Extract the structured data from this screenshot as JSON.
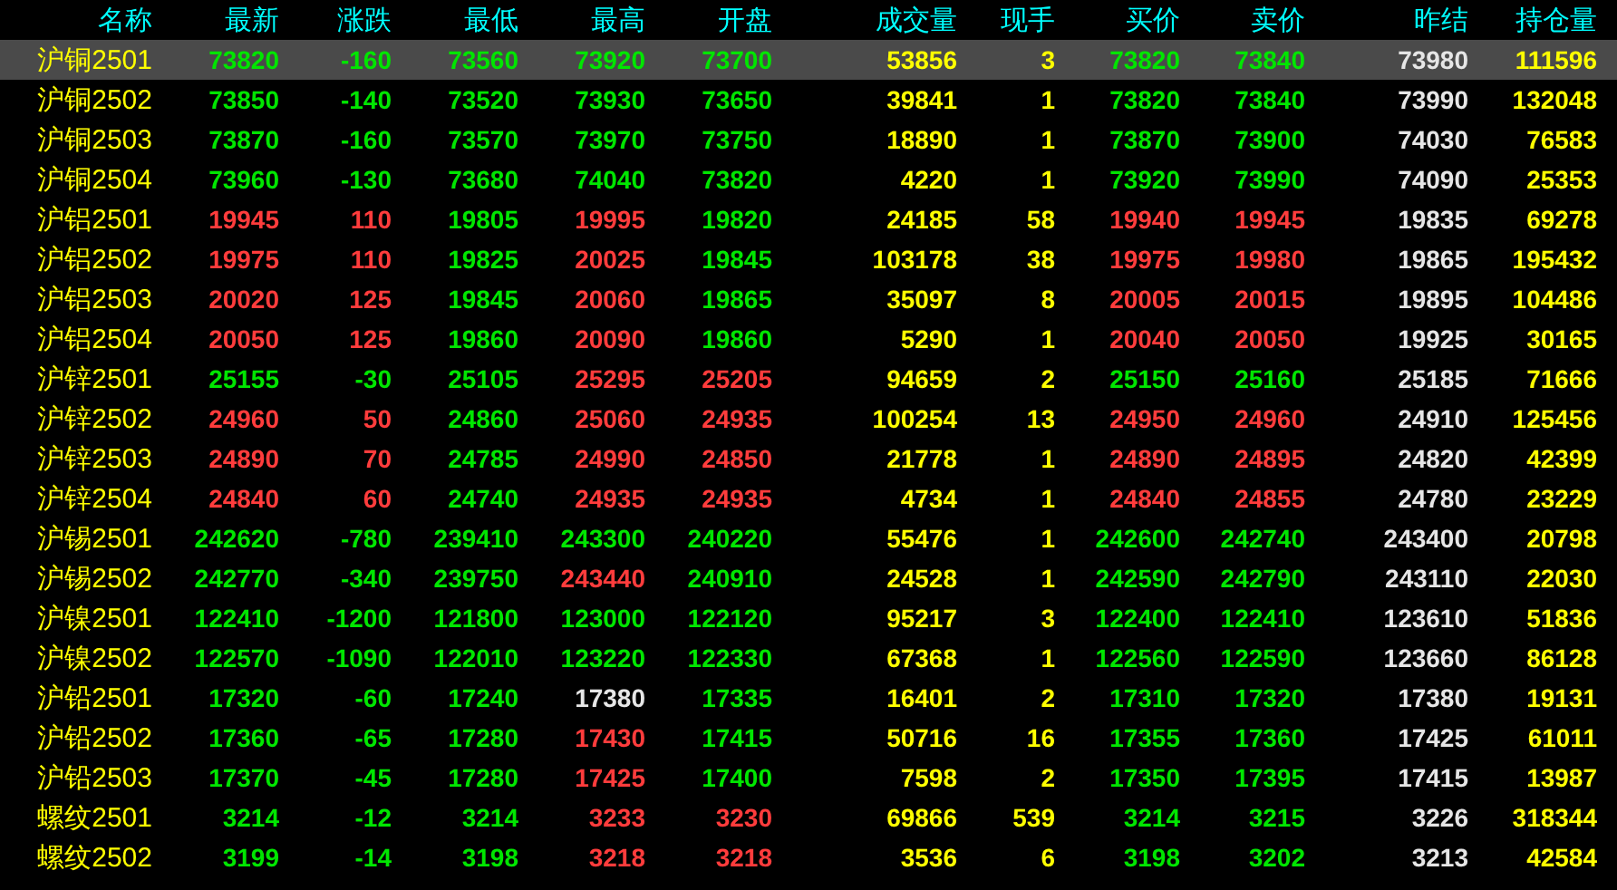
{
  "table": {
    "columns": [
      "名称",
      "最新",
      "涨跌",
      "最低",
      "最高",
      "开盘",
      "成交量",
      "现手",
      "买价",
      "卖价",
      "昨结",
      "持仓量"
    ],
    "rows": [
      {
        "selected": true,
        "cells": [
          {
            "text": "沪铜2501",
            "color": "#ffff00"
          },
          {
            "text": "73820",
            "color": "#00e600"
          },
          {
            "text": "-160",
            "color": "#00e600"
          },
          {
            "text": "73560",
            "color": "#00e600"
          },
          {
            "text": "73920",
            "color": "#00e600"
          },
          {
            "text": "73700",
            "color": "#00e600"
          },
          {
            "text": "53856",
            "color": "#ffff00"
          },
          {
            "text": "3",
            "color": "#ffff00"
          },
          {
            "text": "73820",
            "color": "#00e600"
          },
          {
            "text": "73840",
            "color": "#00e600"
          },
          {
            "text": "73980",
            "color": "#e6e6e6"
          },
          {
            "text": "111596",
            "color": "#ffff00"
          }
        ]
      },
      {
        "selected": false,
        "cells": [
          {
            "text": "沪铜2502",
            "color": "#ffff00"
          },
          {
            "text": "73850",
            "color": "#00e600"
          },
          {
            "text": "-140",
            "color": "#00e600"
          },
          {
            "text": "73520",
            "color": "#00e600"
          },
          {
            "text": "73930",
            "color": "#00e600"
          },
          {
            "text": "73650",
            "color": "#00e600"
          },
          {
            "text": "39841",
            "color": "#ffff00"
          },
          {
            "text": "1",
            "color": "#ffff00"
          },
          {
            "text": "73820",
            "color": "#00e600"
          },
          {
            "text": "73840",
            "color": "#00e600"
          },
          {
            "text": "73990",
            "color": "#e6e6e6"
          },
          {
            "text": "132048",
            "color": "#ffff00"
          }
        ]
      },
      {
        "selected": false,
        "cells": [
          {
            "text": "沪铜2503",
            "color": "#ffff00"
          },
          {
            "text": "73870",
            "color": "#00e600"
          },
          {
            "text": "-160",
            "color": "#00e600"
          },
          {
            "text": "73570",
            "color": "#00e600"
          },
          {
            "text": "73970",
            "color": "#00e600"
          },
          {
            "text": "73750",
            "color": "#00e600"
          },
          {
            "text": "18890",
            "color": "#ffff00"
          },
          {
            "text": "1",
            "color": "#ffff00"
          },
          {
            "text": "73870",
            "color": "#00e600"
          },
          {
            "text": "73900",
            "color": "#00e600"
          },
          {
            "text": "74030",
            "color": "#e6e6e6"
          },
          {
            "text": "76583",
            "color": "#ffff00"
          }
        ]
      },
      {
        "selected": false,
        "cells": [
          {
            "text": "沪铜2504",
            "color": "#ffff00"
          },
          {
            "text": "73960",
            "color": "#00e600"
          },
          {
            "text": "-130",
            "color": "#00e600"
          },
          {
            "text": "73680",
            "color": "#00e600"
          },
          {
            "text": "74040",
            "color": "#00e600"
          },
          {
            "text": "73820",
            "color": "#00e600"
          },
          {
            "text": "4220",
            "color": "#ffff00"
          },
          {
            "text": "1",
            "color": "#ffff00"
          },
          {
            "text": "73920",
            "color": "#00e600"
          },
          {
            "text": "73990",
            "color": "#00e600"
          },
          {
            "text": "74090",
            "color": "#e6e6e6"
          },
          {
            "text": "25353",
            "color": "#ffff00"
          }
        ]
      },
      {
        "selected": false,
        "cells": [
          {
            "text": "沪铝2501",
            "color": "#ffff00"
          },
          {
            "text": "19945",
            "color": "#ff3c3c"
          },
          {
            "text": "110",
            "color": "#ff3c3c"
          },
          {
            "text": "19805",
            "color": "#00e600"
          },
          {
            "text": "19995",
            "color": "#ff3c3c"
          },
          {
            "text": "19820",
            "color": "#00e600"
          },
          {
            "text": "24185",
            "color": "#ffff00"
          },
          {
            "text": "58",
            "color": "#ffff00"
          },
          {
            "text": "19940",
            "color": "#ff3c3c"
          },
          {
            "text": "19945",
            "color": "#ff3c3c"
          },
          {
            "text": "19835",
            "color": "#e6e6e6"
          },
          {
            "text": "69278",
            "color": "#ffff00"
          }
        ]
      },
      {
        "selected": false,
        "cells": [
          {
            "text": "沪铝2502",
            "color": "#ffff00"
          },
          {
            "text": "19975",
            "color": "#ff3c3c"
          },
          {
            "text": "110",
            "color": "#ff3c3c"
          },
          {
            "text": "19825",
            "color": "#00e600"
          },
          {
            "text": "20025",
            "color": "#ff3c3c"
          },
          {
            "text": "19845",
            "color": "#00e600"
          },
          {
            "text": "103178",
            "color": "#ffff00"
          },
          {
            "text": "38",
            "color": "#ffff00"
          },
          {
            "text": "19975",
            "color": "#ff3c3c"
          },
          {
            "text": "19980",
            "color": "#ff3c3c"
          },
          {
            "text": "19865",
            "color": "#e6e6e6"
          },
          {
            "text": "195432",
            "color": "#ffff00"
          }
        ]
      },
      {
        "selected": false,
        "cells": [
          {
            "text": "沪铝2503",
            "color": "#ffff00"
          },
          {
            "text": "20020",
            "color": "#ff3c3c"
          },
          {
            "text": "125",
            "color": "#ff3c3c"
          },
          {
            "text": "19845",
            "color": "#00e600"
          },
          {
            "text": "20060",
            "color": "#ff3c3c"
          },
          {
            "text": "19865",
            "color": "#00e600"
          },
          {
            "text": "35097",
            "color": "#ffff00"
          },
          {
            "text": "8",
            "color": "#ffff00"
          },
          {
            "text": "20005",
            "color": "#ff3c3c"
          },
          {
            "text": "20015",
            "color": "#ff3c3c"
          },
          {
            "text": "19895",
            "color": "#e6e6e6"
          },
          {
            "text": "104486",
            "color": "#ffff00"
          }
        ]
      },
      {
        "selected": false,
        "cells": [
          {
            "text": "沪铝2504",
            "color": "#ffff00"
          },
          {
            "text": "20050",
            "color": "#ff3c3c"
          },
          {
            "text": "125",
            "color": "#ff3c3c"
          },
          {
            "text": "19860",
            "color": "#00e600"
          },
          {
            "text": "20090",
            "color": "#ff3c3c"
          },
          {
            "text": "19860",
            "color": "#00e600"
          },
          {
            "text": "5290",
            "color": "#ffff00"
          },
          {
            "text": "1",
            "color": "#ffff00"
          },
          {
            "text": "20040",
            "color": "#ff3c3c"
          },
          {
            "text": "20050",
            "color": "#ff3c3c"
          },
          {
            "text": "19925",
            "color": "#e6e6e6"
          },
          {
            "text": "30165",
            "color": "#ffff00"
          }
        ]
      },
      {
        "selected": false,
        "cells": [
          {
            "text": "沪锌2501",
            "color": "#ffff00"
          },
          {
            "text": "25155",
            "color": "#00e600"
          },
          {
            "text": "-30",
            "color": "#00e600"
          },
          {
            "text": "25105",
            "color": "#00e600"
          },
          {
            "text": "25295",
            "color": "#ff3c3c"
          },
          {
            "text": "25205",
            "color": "#ff3c3c"
          },
          {
            "text": "94659",
            "color": "#ffff00"
          },
          {
            "text": "2",
            "color": "#ffff00"
          },
          {
            "text": "25150",
            "color": "#00e600"
          },
          {
            "text": "25160",
            "color": "#00e600"
          },
          {
            "text": "25185",
            "color": "#e6e6e6"
          },
          {
            "text": "71666",
            "color": "#ffff00"
          }
        ]
      },
      {
        "selected": false,
        "cells": [
          {
            "text": "沪锌2502",
            "color": "#ffff00"
          },
          {
            "text": "24960",
            "color": "#ff3c3c"
          },
          {
            "text": "50",
            "color": "#ff3c3c"
          },
          {
            "text": "24860",
            "color": "#00e600"
          },
          {
            "text": "25060",
            "color": "#ff3c3c"
          },
          {
            "text": "24935",
            "color": "#ff3c3c"
          },
          {
            "text": "100254",
            "color": "#ffff00"
          },
          {
            "text": "13",
            "color": "#ffff00"
          },
          {
            "text": "24950",
            "color": "#ff3c3c"
          },
          {
            "text": "24960",
            "color": "#ff3c3c"
          },
          {
            "text": "24910",
            "color": "#e6e6e6"
          },
          {
            "text": "125456",
            "color": "#ffff00"
          }
        ]
      },
      {
        "selected": false,
        "cells": [
          {
            "text": "沪锌2503",
            "color": "#ffff00"
          },
          {
            "text": "24890",
            "color": "#ff3c3c"
          },
          {
            "text": "70",
            "color": "#ff3c3c"
          },
          {
            "text": "24785",
            "color": "#00e600"
          },
          {
            "text": "24990",
            "color": "#ff3c3c"
          },
          {
            "text": "24850",
            "color": "#ff3c3c"
          },
          {
            "text": "21778",
            "color": "#ffff00"
          },
          {
            "text": "1",
            "color": "#ffff00"
          },
          {
            "text": "24890",
            "color": "#ff3c3c"
          },
          {
            "text": "24895",
            "color": "#ff3c3c"
          },
          {
            "text": "24820",
            "color": "#e6e6e6"
          },
          {
            "text": "42399",
            "color": "#ffff00"
          }
        ]
      },
      {
        "selected": false,
        "cells": [
          {
            "text": "沪锌2504",
            "color": "#ffff00"
          },
          {
            "text": "24840",
            "color": "#ff3c3c"
          },
          {
            "text": "60",
            "color": "#ff3c3c"
          },
          {
            "text": "24740",
            "color": "#00e600"
          },
          {
            "text": "24935",
            "color": "#ff3c3c"
          },
          {
            "text": "24935",
            "color": "#ff3c3c"
          },
          {
            "text": "4734",
            "color": "#ffff00"
          },
          {
            "text": "1",
            "color": "#ffff00"
          },
          {
            "text": "24840",
            "color": "#ff3c3c"
          },
          {
            "text": "24855",
            "color": "#ff3c3c"
          },
          {
            "text": "24780",
            "color": "#e6e6e6"
          },
          {
            "text": "23229",
            "color": "#ffff00"
          }
        ]
      },
      {
        "selected": false,
        "cells": [
          {
            "text": "沪锡2501",
            "color": "#ffff00"
          },
          {
            "text": "242620",
            "color": "#00e600"
          },
          {
            "text": "-780",
            "color": "#00e600"
          },
          {
            "text": "239410",
            "color": "#00e600"
          },
          {
            "text": "243300",
            "color": "#00e600"
          },
          {
            "text": "240220",
            "color": "#00e600"
          },
          {
            "text": "55476",
            "color": "#ffff00"
          },
          {
            "text": "1",
            "color": "#ffff00"
          },
          {
            "text": "242600",
            "color": "#00e600"
          },
          {
            "text": "242740",
            "color": "#00e600"
          },
          {
            "text": "243400",
            "color": "#e6e6e6"
          },
          {
            "text": "20798",
            "color": "#ffff00"
          }
        ]
      },
      {
        "selected": false,
        "cells": [
          {
            "text": "沪锡2502",
            "color": "#ffff00"
          },
          {
            "text": "242770",
            "color": "#00e600"
          },
          {
            "text": "-340",
            "color": "#00e600"
          },
          {
            "text": "239750",
            "color": "#00e600"
          },
          {
            "text": "243440",
            "color": "#ff3c3c"
          },
          {
            "text": "240910",
            "color": "#00e600"
          },
          {
            "text": "24528",
            "color": "#ffff00"
          },
          {
            "text": "1",
            "color": "#ffff00"
          },
          {
            "text": "242590",
            "color": "#00e600"
          },
          {
            "text": "242790",
            "color": "#00e600"
          },
          {
            "text": "243110",
            "color": "#e6e6e6"
          },
          {
            "text": "22030",
            "color": "#ffff00"
          }
        ]
      },
      {
        "selected": false,
        "cells": [
          {
            "text": "沪镍2501",
            "color": "#ffff00"
          },
          {
            "text": "122410",
            "color": "#00e600"
          },
          {
            "text": "-1200",
            "color": "#00e600"
          },
          {
            "text": "121800",
            "color": "#00e600"
          },
          {
            "text": "123000",
            "color": "#00e600"
          },
          {
            "text": "122120",
            "color": "#00e600"
          },
          {
            "text": "95217",
            "color": "#ffff00"
          },
          {
            "text": "3",
            "color": "#ffff00"
          },
          {
            "text": "122400",
            "color": "#00e600"
          },
          {
            "text": "122410",
            "color": "#00e600"
          },
          {
            "text": "123610",
            "color": "#e6e6e6"
          },
          {
            "text": "51836",
            "color": "#ffff00"
          }
        ]
      },
      {
        "selected": false,
        "cells": [
          {
            "text": "沪镍2502",
            "color": "#ffff00"
          },
          {
            "text": "122570",
            "color": "#00e600"
          },
          {
            "text": "-1090",
            "color": "#00e600"
          },
          {
            "text": "122010",
            "color": "#00e600"
          },
          {
            "text": "123220",
            "color": "#00e600"
          },
          {
            "text": "122330",
            "color": "#00e600"
          },
          {
            "text": "67368",
            "color": "#ffff00"
          },
          {
            "text": "1",
            "color": "#ffff00"
          },
          {
            "text": "122560",
            "color": "#00e600"
          },
          {
            "text": "122590",
            "color": "#00e600"
          },
          {
            "text": "123660",
            "color": "#e6e6e6"
          },
          {
            "text": "86128",
            "color": "#ffff00"
          }
        ]
      },
      {
        "selected": false,
        "cells": [
          {
            "text": "沪铅2501",
            "color": "#ffff00"
          },
          {
            "text": "17320",
            "color": "#00e600"
          },
          {
            "text": "-60",
            "color": "#00e600"
          },
          {
            "text": "17240",
            "color": "#00e600"
          },
          {
            "text": "17380",
            "color": "#e6e6e6"
          },
          {
            "text": "17335",
            "color": "#00e600"
          },
          {
            "text": "16401",
            "color": "#ffff00"
          },
          {
            "text": "2",
            "color": "#ffff00"
          },
          {
            "text": "17310",
            "color": "#00e600"
          },
          {
            "text": "17320",
            "color": "#00e600"
          },
          {
            "text": "17380",
            "color": "#e6e6e6"
          },
          {
            "text": "19131",
            "color": "#ffff00"
          }
        ]
      },
      {
        "selected": false,
        "cells": [
          {
            "text": "沪铅2502",
            "color": "#ffff00"
          },
          {
            "text": "17360",
            "color": "#00e600"
          },
          {
            "text": "-65",
            "color": "#00e600"
          },
          {
            "text": "17280",
            "color": "#00e600"
          },
          {
            "text": "17430",
            "color": "#ff3c3c"
          },
          {
            "text": "17415",
            "color": "#00e600"
          },
          {
            "text": "50716",
            "color": "#ffff00"
          },
          {
            "text": "16",
            "color": "#ffff00"
          },
          {
            "text": "17355",
            "color": "#00e600"
          },
          {
            "text": "17360",
            "color": "#00e600"
          },
          {
            "text": "17425",
            "color": "#e6e6e6"
          },
          {
            "text": "61011",
            "color": "#ffff00"
          }
        ]
      },
      {
        "selected": false,
        "cells": [
          {
            "text": "沪铅2503",
            "color": "#ffff00"
          },
          {
            "text": "17370",
            "color": "#00e600"
          },
          {
            "text": "-45",
            "color": "#00e600"
          },
          {
            "text": "17280",
            "color": "#00e600"
          },
          {
            "text": "17425",
            "color": "#ff3c3c"
          },
          {
            "text": "17400",
            "color": "#00e600"
          },
          {
            "text": "7598",
            "color": "#ffff00"
          },
          {
            "text": "2",
            "color": "#ffff00"
          },
          {
            "text": "17350",
            "color": "#00e600"
          },
          {
            "text": "17395",
            "color": "#00e600"
          },
          {
            "text": "17415",
            "color": "#e6e6e6"
          },
          {
            "text": "13987",
            "color": "#ffff00"
          }
        ]
      },
      {
        "selected": false,
        "cells": [
          {
            "text": "螺纹2501",
            "color": "#ffff00"
          },
          {
            "text": "3214",
            "color": "#00e600"
          },
          {
            "text": "-12",
            "color": "#00e600"
          },
          {
            "text": "3214",
            "color": "#00e600"
          },
          {
            "text": "3233",
            "color": "#ff3c3c"
          },
          {
            "text": "3230",
            "color": "#ff3c3c"
          },
          {
            "text": "69866",
            "color": "#ffff00"
          },
          {
            "text": "539",
            "color": "#ffff00"
          },
          {
            "text": "3214",
            "color": "#00e600"
          },
          {
            "text": "3215",
            "color": "#00e600"
          },
          {
            "text": "3226",
            "color": "#e6e6e6"
          },
          {
            "text": "318344",
            "color": "#ffff00"
          }
        ]
      },
      {
        "selected": false,
        "cells": [
          {
            "text": "螺纹2502",
            "color": "#ffff00"
          },
          {
            "text": "3199",
            "color": "#00e600"
          },
          {
            "text": "-14",
            "color": "#00e600"
          },
          {
            "text": "3198",
            "color": "#00e600"
          },
          {
            "text": "3218",
            "color": "#ff3c3c"
          },
          {
            "text": "3218",
            "color": "#ff3c3c"
          },
          {
            "text": "3536",
            "color": "#ffff00"
          },
          {
            "text": "6",
            "color": "#ffff00"
          },
          {
            "text": "3198",
            "color": "#00e600"
          },
          {
            "text": "3202",
            "color": "#00e600"
          },
          {
            "text": "3213",
            "color": "#e6e6e6"
          },
          {
            "text": "42584",
            "color": "#ffff00"
          }
        ]
      }
    ]
  }
}
